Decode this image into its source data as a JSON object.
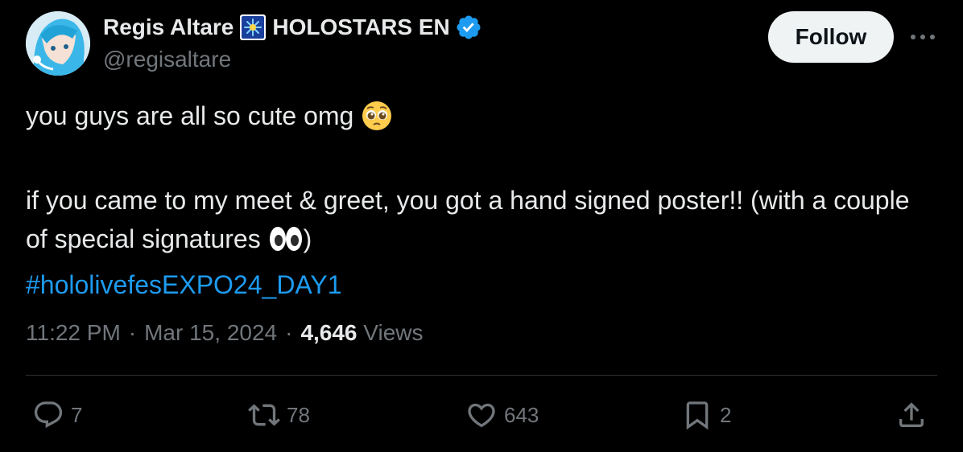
{
  "author": {
    "display_name": "Regis Altare",
    "affiliation": "HOLOSTARS EN",
    "handle": "@regisaltare",
    "avatar_icon": "avatar-blue-hair",
    "affiliation_badge_icon": "holostars-badge-icon",
    "verified_icon": "verified-badge-icon"
  },
  "header": {
    "follow_label": "Follow",
    "more_icon": "more-options-icon"
  },
  "tweet": {
    "line1": "you guys are all so cute omg",
    "line1_emoji": "pleading-face-emoji",
    "line2": "if you came to my meet & greet, you got a hand signed poster!! (with a couple of special signatures",
    "line2_emoji": "eyes-emoji",
    "line2_end": ")",
    "hashtag": "#hololivefesEXPO24_DAY1"
  },
  "meta": {
    "time": "11:22 PM",
    "separator": "·",
    "date": "Mar 15, 2024",
    "views_count": "4,646",
    "views_label": "Views"
  },
  "actions": {
    "replies": "7",
    "reposts": "78",
    "likes": "643",
    "bookmarks": "2"
  },
  "colors": {
    "background": "#000000",
    "text_primary": "#e7e9ea",
    "text_secondary": "#71767b",
    "link": "#1d9bf0",
    "verified": "#1d9bf0",
    "divider": "#2f3336",
    "follow_bg": "#eff3f4"
  }
}
